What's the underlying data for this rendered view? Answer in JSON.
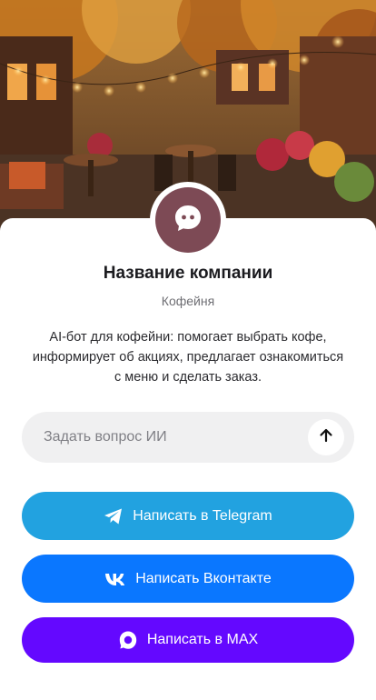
{
  "hero": {
    "scene": "autumn-cafe-terrace-photo"
  },
  "company": {
    "avatar_icon": "chat-bot-icon",
    "name": "Название компании",
    "type": "Кофейня",
    "description": "AI-бот для кофейни: помогает выбрать кофе, информирует об акциях, предлагает ознакомиться с меню и сделать заказ."
  },
  "ask": {
    "placeholder": "Задать вопрос ИИ",
    "value": "",
    "send_icon": "arrow-up-icon"
  },
  "actions": {
    "telegram": {
      "label": "Написать в Telegram",
      "icon": "telegram-icon",
      "color": "#22a2e0"
    },
    "vk": {
      "label": "Написать Вконтакте",
      "icon": "vk-icon",
      "color": "#0a77ff"
    },
    "max": {
      "label": "Написать в MAX",
      "icon": "max-icon",
      "color": "#6408ff"
    }
  },
  "colors": {
    "avatar": "#7d4a55",
    "input_bg": "#f0f0f1"
  }
}
